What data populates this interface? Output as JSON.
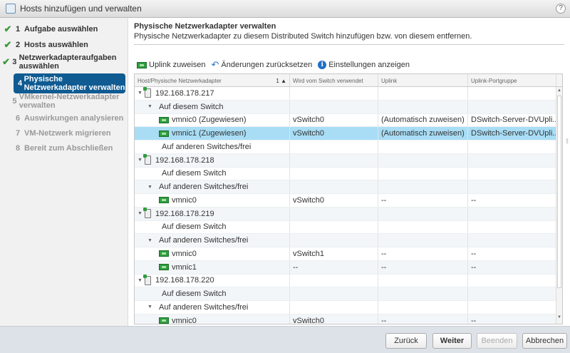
{
  "window": {
    "title": "Hosts hinzufügen und verwalten",
    "help": "?"
  },
  "steps": [
    {
      "num": "1",
      "label": "Aufgabe auswählen",
      "state": "done"
    },
    {
      "num": "2",
      "label": "Hosts auswählen",
      "state": "done"
    },
    {
      "num": "3",
      "label": "Netzwerkadapteraufgaben auswählen",
      "state": "done"
    },
    {
      "num": "4",
      "label": "Physische Netzwerkadapter verwalten",
      "state": "active"
    },
    {
      "num": "5",
      "label": "VMkernel-Netzwerkadapter verwalten",
      "state": "todo"
    },
    {
      "num": "6",
      "label": "Auswirkungen analysieren",
      "state": "todo"
    },
    {
      "num": "7",
      "label": "VM-Netzwerk migrieren",
      "state": "todo"
    },
    {
      "num": "8",
      "label": "Bereit zum Abschließen",
      "state": "todo"
    }
  ],
  "main": {
    "title": "Physische Netzwerkadapter verwalten",
    "subtitle": "Physische Netzwerkadapter zu diesem Distributed Switch hinzufügen bzw. von diesem entfernen."
  },
  "toolbar": {
    "assign": "Uplink zuweisen",
    "reset": "Änderungen zurücksetzen",
    "settings": "Einstellungen anzeigen"
  },
  "table": {
    "columns": [
      "Host/Physische Netzwerkadapter",
      "Wird vom Switch verwendet",
      "Uplink",
      "Uplink-Portgruppe"
    ],
    "sort_indicator": "1 ▲",
    "rows": [
      {
        "type": "host",
        "name": "192.168.178.217",
        "c1": "",
        "c2": "",
        "c3": ""
      },
      {
        "type": "group",
        "expand": true,
        "name": "Auf diesem Switch",
        "c1": "",
        "c2": "",
        "c3": ""
      },
      {
        "type": "nic",
        "name": "vmnic0 (Zugewiesen)",
        "c1": "vSwitch0",
        "c2": "(Automatisch zuweisen)",
        "c3": "DSwitch-Server-DVUpli..."
      },
      {
        "type": "nic",
        "name": "vmnic1 (Zugewiesen)",
        "c1": "vSwitch0",
        "c2": "(Automatisch zuweisen)",
        "c3": "DSwitch-Server-DVUpli...",
        "selected": true
      },
      {
        "type": "group",
        "expand": false,
        "name": "Auf anderen Switches/frei",
        "c1": "",
        "c2": "",
        "c3": ""
      },
      {
        "type": "host",
        "name": "192.168.178.218",
        "c1": "",
        "c2": "",
        "c3": ""
      },
      {
        "type": "group",
        "expand": false,
        "name": "Auf diesem Switch",
        "c1": "",
        "c2": "",
        "c3": ""
      },
      {
        "type": "group",
        "expand": true,
        "name": "Auf anderen Switches/frei",
        "c1": "",
        "c2": "",
        "c3": ""
      },
      {
        "type": "nic",
        "name": "vmnic0",
        "c1": "vSwitch0",
        "c2": "--",
        "c3": "--"
      },
      {
        "type": "host",
        "name": "192.168.178.219",
        "c1": "",
        "c2": "",
        "c3": ""
      },
      {
        "type": "group",
        "expand": false,
        "name": "Auf diesem Switch",
        "c1": "",
        "c2": "",
        "c3": ""
      },
      {
        "type": "group",
        "expand": true,
        "name": "Auf anderen Switches/frei",
        "c1": "",
        "c2": "",
        "c3": ""
      },
      {
        "type": "nic",
        "name": "vmnic0",
        "c1": "vSwitch1",
        "c2": "--",
        "c3": "--"
      },
      {
        "type": "nic",
        "name": "vmnic1",
        "c1": "--",
        "c2": "--",
        "c3": "--"
      },
      {
        "type": "host",
        "name": "192.168.178.220",
        "c1": "",
        "c2": "",
        "c3": ""
      },
      {
        "type": "group",
        "expand": false,
        "name": "Auf diesem Switch",
        "c1": "",
        "c2": "",
        "c3": ""
      },
      {
        "type": "group",
        "expand": true,
        "name": "Auf anderen Switches/frei",
        "c1": "",
        "c2": "",
        "c3": ""
      },
      {
        "type": "nic",
        "name": "vmnic0",
        "c1": "vSwitch0",
        "c2": "--",
        "c3": "--"
      }
    ]
  },
  "buttons": {
    "back": "Zurück",
    "next": "Weiter",
    "finish": "Beenden",
    "cancel": "Abbrechen"
  }
}
